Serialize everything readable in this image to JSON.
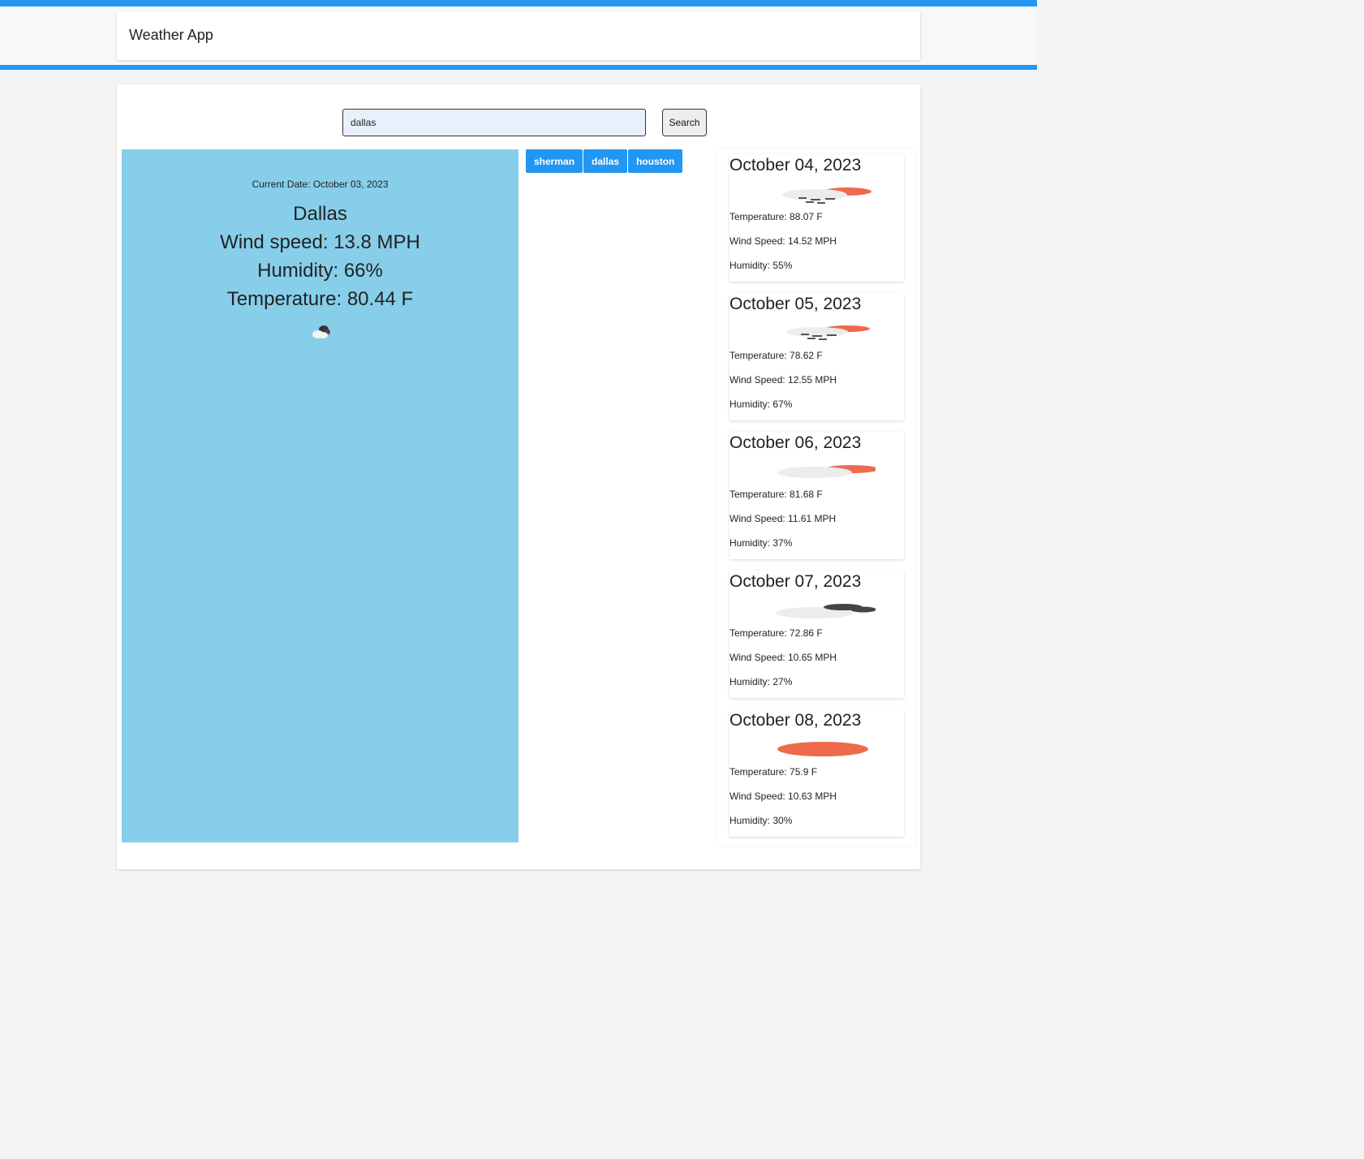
{
  "app": {
    "title": "Weather App"
  },
  "search": {
    "value": "dallas",
    "button_label": "Search"
  },
  "current": {
    "date": "Current Date: October 03, 2023",
    "city": "Dallas",
    "wind": "Wind speed: 13.8 MPH",
    "humidity": "Humidity: 66%",
    "temperature": "Temperature: 80.44 F",
    "icon": "cloud-icon"
  },
  "history": [
    {
      "label": "sherman"
    },
    {
      "label": "dallas"
    },
    {
      "label": "houston"
    }
  ],
  "forecast": [
    {
      "date": "October 04, 2023",
      "temp": "Temperature: 88.07 F",
      "wind": "Wind Speed: 14.52 MPH",
      "humidity": "Humidity: 55%",
      "icon": "rain-cloud-sun-icon"
    },
    {
      "date": "October 05, 2023",
      "temp": "Temperature: 78.62 F",
      "wind": "Wind Speed: 12.55 MPH",
      "humidity": "Humidity: 67%",
      "icon": "rain-cloud-sun-icon"
    },
    {
      "date": "October 06, 2023",
      "temp": "Temperature: 81.68 F",
      "wind": "Wind Speed: 11.61 MPH",
      "humidity": "Humidity: 37%",
      "icon": "cloud-sun-icon"
    },
    {
      "date": "October 07, 2023",
      "temp": "Temperature: 72.86 F",
      "wind": "Wind Speed: 10.65 MPH",
      "humidity": "Humidity: 27%",
      "icon": "dark-cloud-icon"
    },
    {
      "date": "October 08, 2023",
      "temp": "Temperature: 75.9 F",
      "wind": "Wind Speed: 10.63 MPH",
      "humidity": "Humidity: 30%",
      "icon": "sun-icon"
    }
  ],
  "colors": {
    "accent": "#2196f3",
    "current_panel": "#87ceea",
    "sun": "#ee6a4b"
  }
}
